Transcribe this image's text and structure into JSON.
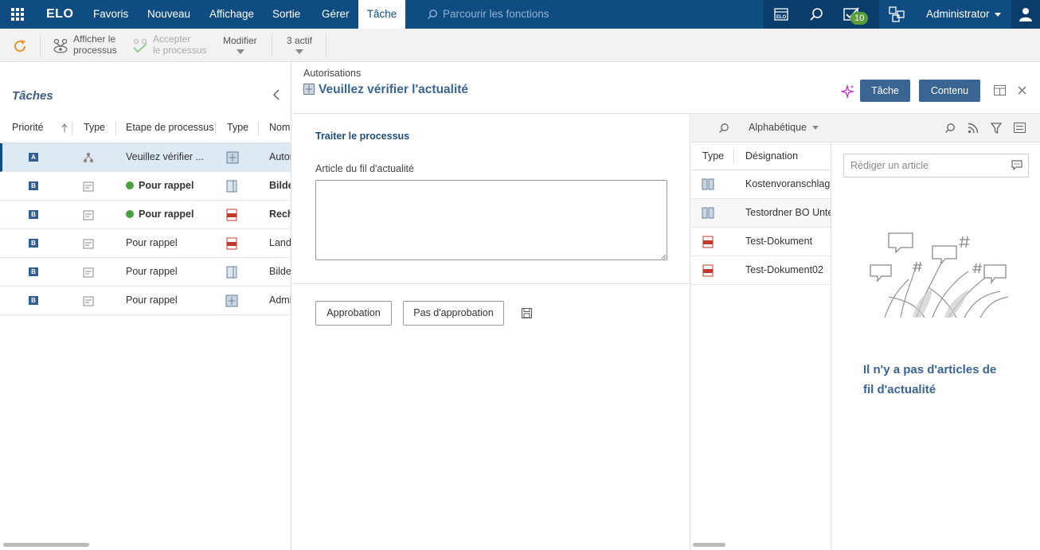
{
  "topbar": {
    "logo": "ELO",
    "menu": [
      "Favoris",
      "Nouveau",
      "Affichage",
      "Sortie",
      "Gérer",
      "Tâche"
    ],
    "active_menu": "Tâche",
    "search_placeholder": "Parcourir les fonctions",
    "tasks_badge": "10",
    "user": "Administrator"
  },
  "toolbar": {
    "refresh_icon": "refresh-icon",
    "show_process": [
      "Afficher le",
      "processus"
    ],
    "accept_process": [
      "Accepter",
      "le processus"
    ],
    "modify": "Modifier",
    "active_count": "3 actif"
  },
  "tasks": {
    "title": "Tâches",
    "columns": [
      "Priorité",
      "Type",
      "Etape de processus",
      "Type",
      "Nom"
    ],
    "rows": [
      {
        "priority": "A",
        "step": "Veuillez vérifier ...",
        "name": "Autor",
        "bold": false,
        "dot": false,
        "selected": true
      },
      {
        "priority": "B",
        "step": "Pour rappel",
        "name": "Bilde",
        "bold": true,
        "dot": true,
        "selected": false
      },
      {
        "priority": "B",
        "step": "Pour rappel",
        "name": "Rech",
        "bold": true,
        "dot": true,
        "selected": false
      },
      {
        "priority": "B",
        "step": "Pour rappel",
        "name": "Land",
        "bold": false,
        "dot": false,
        "selected": false
      },
      {
        "priority": "B",
        "step": "Pour rappel",
        "name": "Bilde",
        "bold": false,
        "dot": false,
        "selected": false
      },
      {
        "priority": "B",
        "step": "Pour rappel",
        "name": "Admi",
        "bold": false,
        "dot": false,
        "selected": false
      }
    ]
  },
  "detail": {
    "breadcrumb": "Autorisations",
    "title": "Veuillez vérifier l'actualité",
    "task_button": "Tâche",
    "content_button": "Contenu"
  },
  "form": {
    "section_title": "Traiter le processus",
    "field_label": "Article du fil d'actualité",
    "field_value": "",
    "approve": "Approbation",
    "reject": "Pas d'approbation"
  },
  "documents": {
    "sort": "Alphabétique",
    "columns": [
      "Type",
      "Désignation"
    ],
    "rows": [
      "Kostenvoranschlag",
      "Testordner BO Unte",
      "Test-Dokument",
      "Test-Dokument02"
    ]
  },
  "feed": {
    "placeholder": "Rédiger un article",
    "empty_line1": "Il n'y a pas d'articles de",
    "empty_line2": "fil d'actualité"
  },
  "colors": {
    "brand": "#0f4c81",
    "accent_button": "#3a6592",
    "status_green": "#4aa03f",
    "refresh": "#e8952a",
    "ai_magenta": "#c02fd0"
  }
}
